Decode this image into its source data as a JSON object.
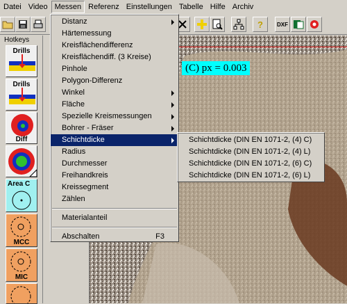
{
  "menubar": {
    "items": [
      "Datei",
      "Video",
      "Messen",
      "Referenz",
      "Einstellungen",
      "Tabelle",
      "Hilfe",
      "Archiv"
    ],
    "open_index": 2
  },
  "toolbar": {
    "icons": [
      "open-folder-icon",
      "save-icon",
      "print-icon",
      "close-x-icon",
      "crosshair-icon",
      "zoom-document-icon",
      "network-icon",
      "help-icon",
      "dxf-export-icon",
      "excel-export-icon",
      "settings-gear-icon"
    ],
    "dxf_label": "DXF"
  },
  "hotkeys": {
    "title": "Hotkeys",
    "buttons": [
      "Drills",
      "Drills",
      "Diff",
      "",
      "Area C",
      "MCC",
      "MIC",
      ""
    ]
  },
  "image": {
    "scale_label": "(C) px = 0.003",
    "accent_cyan": "#00ffff",
    "line_color": "#e02020"
  },
  "messen_menu": {
    "items": [
      {
        "label": "Distanz",
        "submenu": true
      },
      {
        "label": "Härtemessung",
        "submenu": false
      },
      {
        "label": "Kreisflächendifferenz",
        "submenu": false
      },
      {
        "label": "Kreisflächendiff. (3 Kreise)",
        "submenu": false
      },
      {
        "label": "Pinhole",
        "submenu": false
      },
      {
        "label": "Polygon-Differenz",
        "submenu": false
      },
      {
        "label": "Winkel",
        "submenu": true
      },
      {
        "label": "Fläche",
        "submenu": true
      },
      {
        "label": "Spezielle Kreismessungen",
        "submenu": true
      },
      {
        "label": "Bohrer - Fräser",
        "submenu": true
      },
      {
        "label": "Schichtdicke",
        "submenu": true,
        "highlighted": true
      },
      {
        "label": "Radius",
        "submenu": false
      },
      {
        "label": "Durchmesser",
        "submenu": false
      },
      {
        "label": "Freihandkreis",
        "submenu": false
      },
      {
        "label": "Kreissegment",
        "submenu": false
      },
      {
        "label": "Zählen",
        "submenu": false
      }
    ],
    "material_label": "Materialanteil",
    "off_label": "Abschalten",
    "off_shortcut": "F3",
    "highlight_color": "#0a246a"
  },
  "schichtdicke_submenu": {
    "items": [
      "Schichtdicke (DIN EN 1071-2, (4) C)",
      "Schichtdicke (DIN EN 1071-2, (4) L)",
      "Schichtdicke (DIN EN 1071-2, (6) C)",
      "Schichtdicke (DIN EN 1071-2, (6) L)"
    ]
  }
}
